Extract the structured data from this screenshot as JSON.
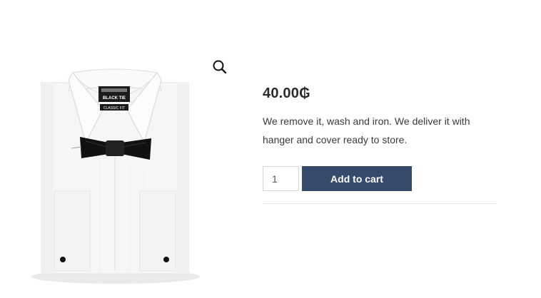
{
  "product": {
    "price_value": "40.00",
    "currency_symbol": "₲",
    "description": "We remove it, wash and iron. We deliver it with hanger and cover ready to store.",
    "quantity": "1",
    "add_to_cart_label": "Add to cart",
    "image": {
      "label_brand": "BLACK TIE",
      "label_fit": "CLASSIC FIT",
      "icon": "shirt-with-bow-tie"
    },
    "zoom_icon": "magnifier-icon"
  },
  "colors": {
    "button": "#364a6b",
    "text": "#2b2b2b",
    "divider": "#e6e6e6"
  }
}
